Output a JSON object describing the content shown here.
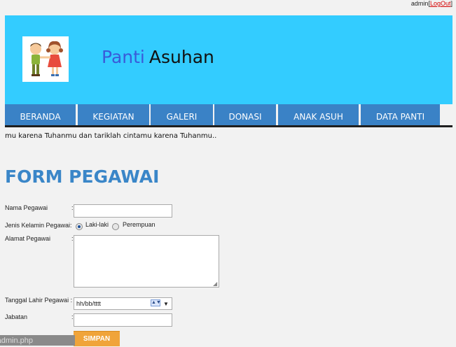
{
  "topbar": {
    "user": "admin",
    "logout": "LogOut"
  },
  "site": {
    "title_part1": "Panti",
    "title_part2": "Asuhan"
  },
  "nav": {
    "items": [
      {
        "label": "BERANDA"
      },
      {
        "label": "KEGIATAN"
      },
      {
        "label": "GALERI"
      },
      {
        "label": "DONASI"
      },
      {
        "label": "ANAK ASUH"
      },
      {
        "label": "DATA PANTI"
      }
    ]
  },
  "marquee": {
    "text": "mu karena Tuhanmu dan tariklah cintamu karena Tuhanmu.."
  },
  "form": {
    "title": "FORM PEGAWAI",
    "nama_label": "Nama Pegawai",
    "jk_label": "Jenis Kelamin Pegawai:",
    "jk_options": [
      "Laki-laki",
      "Perempuan"
    ],
    "jk_selected": "Laki-laki",
    "alamat_label": "Alamat Pegawai",
    "tgl_label": "Tanggal Lahir Pegawai :",
    "tgl_placeholder": "hh/bb/tttt",
    "jabatan_label": "Jabatan",
    "colon": ":",
    "submit": "SIMPAN"
  },
  "statusbar": {
    "text": "-admin.php"
  },
  "colors": {
    "header": "#33ccff",
    "nav": "#3a82c6",
    "title": "#3a86c8",
    "button": "#f0a43a"
  },
  "icons": {
    "logo": "children-illustration",
    "date_spinner": "spinner-icon",
    "dropdown": "chevron-down-icon"
  }
}
